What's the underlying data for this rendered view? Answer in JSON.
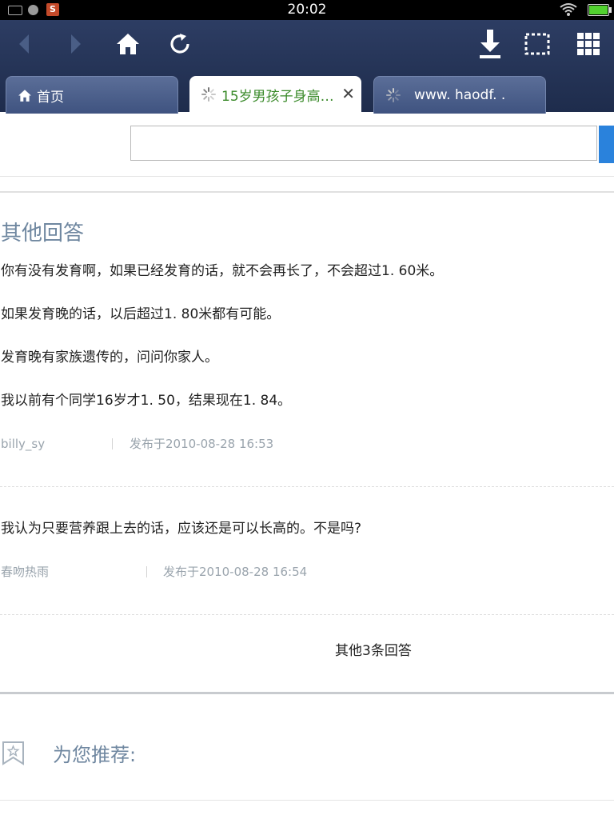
{
  "status_bar": {
    "time": "20:02",
    "icons": [
      "image-icon",
      "chat-icon",
      "s-app-icon",
      "wifi-icon",
      "battery-icon"
    ]
  },
  "toolbar": {
    "buttons": [
      "back-icon",
      "forward-icon",
      "home-icon",
      "reload-icon",
      "download-icon",
      "select-icon",
      "grid-icon"
    ]
  },
  "tabs": [
    {
      "label": "首页",
      "icon": "home-icon"
    },
    {
      "label": "15岁男孩子身高…",
      "icon": "loading-icon",
      "close": "✕"
    },
    {
      "label": "www. haodf. .",
      "icon": "loading-icon"
    }
  ],
  "search": {
    "value": "",
    "placeholder": ""
  },
  "section": {
    "title": "其他回答"
  },
  "answers": [
    {
      "paragraphs": [
        "你有没有发育啊，如果已经发育的话，就不会再长了，不会超过1. 60米。",
        "如果发育晚的话，以后超过1. 80米都有可能。",
        "发育晚有家族遗传的，问问你家人。",
        "我以前有个同学16岁才1. 50，结果现在1. 84。"
      ],
      "author": "billy_sy",
      "date": "发布于2010-08-28  16:53"
    },
    {
      "paragraphs": [
        "我认为只要营养跟上去的话，应该还是可以长高的。不是吗?"
      ],
      "author": "春吻热雨",
      "date": "发布于2010-08-28  16:54"
    }
  ],
  "more_answers": "其他3条回答",
  "recommend": {
    "title": "为您推荐:"
  },
  "colors": {
    "accent": "#2a82dc",
    "section_title": "#6f87a0",
    "chrome": "#2d3d63",
    "tab_active_text": "#3a8a2a"
  }
}
